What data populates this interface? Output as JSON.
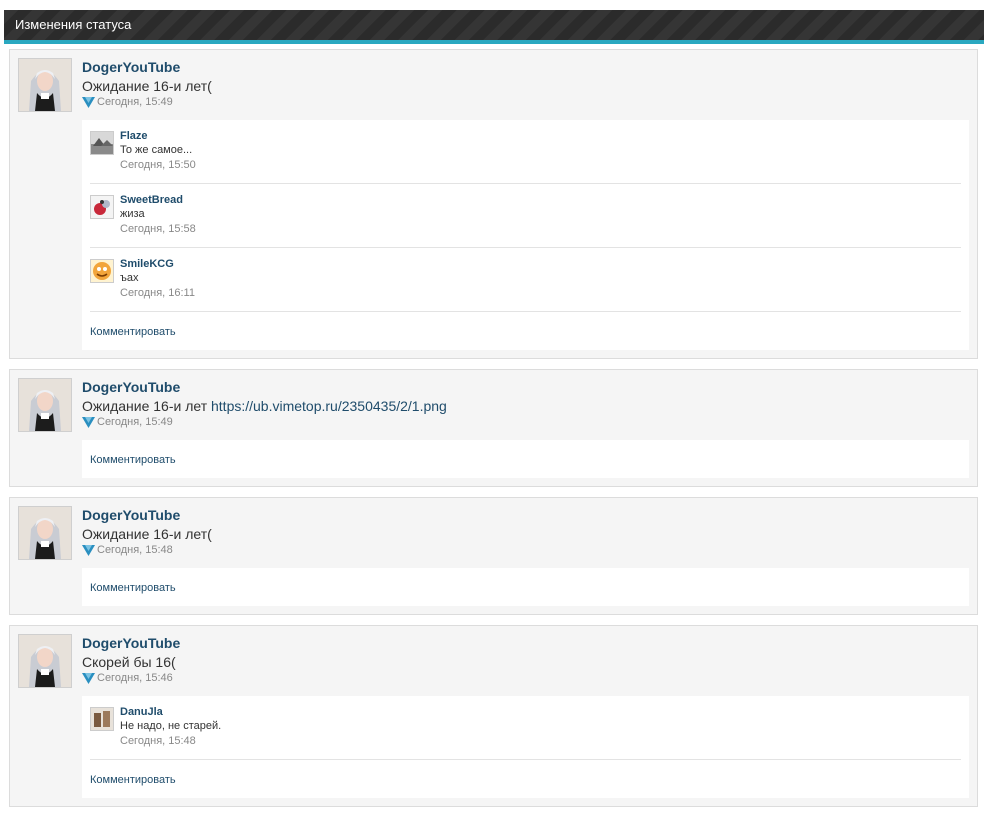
{
  "header": {
    "title": "Изменения статуса"
  },
  "colors": {
    "accent": "#2aa8c0",
    "link": "#1f4c6b",
    "header_bg": "#2f2f2f"
  },
  "entries": [
    {
      "user": "DogerYouTube",
      "text": "Ожидание 16-и лет(",
      "link": "",
      "time": "Сегодня, 15:49",
      "comments": [
        {
          "user": "Flaze",
          "text": "То же самое...",
          "time": "Сегодня, 15:50",
          "avatar": "grey-photo"
        },
        {
          "user": "SweetBread",
          "text": "жиза",
          "time": "Сегодня, 15:58",
          "avatar": "red-figure"
        },
        {
          "user": "SmileKCG",
          "text": "ъах",
          "time": "Сегодня, 16:11",
          "avatar": "orange-face"
        }
      ],
      "comment_label": "Комментировать"
    },
    {
      "user": "DogerYouTube",
      "text": "Ожидание 16-и лет ",
      "link": "https://ub.vimetop.ru/2350435/2/1.png",
      "time": "Сегодня, 15:49",
      "comments": [],
      "comment_label": "Комментировать"
    },
    {
      "user": "DogerYouTube",
      "text": "Ожидание 16-и лет(",
      "link": "",
      "time": "Сегодня, 15:48",
      "comments": [],
      "comment_label": "Комментировать"
    },
    {
      "user": "DogerYouTube",
      "text": "Скорей бы 16(",
      "link": "",
      "time": "Сегодня, 15:46",
      "comments": [
        {
          "user": "DanuJla",
          "text": "Не надо, не старей.",
          "time": "Сегодня, 15:48",
          "avatar": "brown-photo"
        }
      ],
      "comment_label": "Комментировать"
    }
  ]
}
